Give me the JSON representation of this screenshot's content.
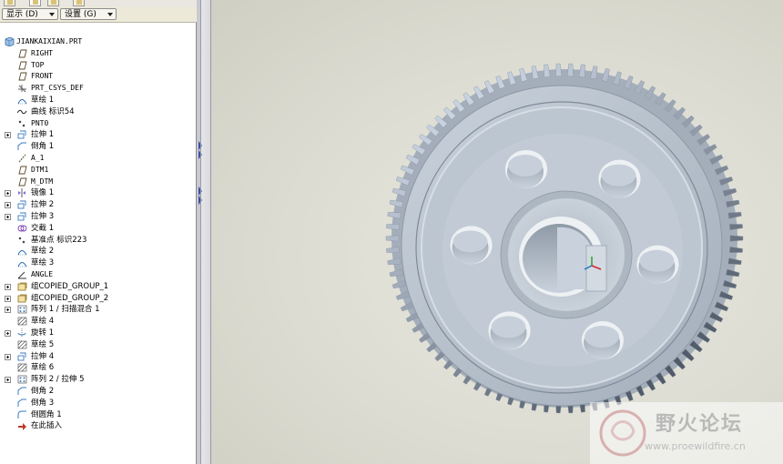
{
  "menubar": {
    "display_label": "显示 (D)",
    "settings_label": "设置 (G)"
  },
  "model_tree": {
    "root": "JIANKAIXIAN.PRT",
    "items": [
      {
        "label": "RIGHT",
        "icon": "datum-plane-icon",
        "expandable": false
      },
      {
        "label": "TOP",
        "icon": "datum-plane-icon",
        "expandable": false
      },
      {
        "label": "FRONT",
        "icon": "datum-plane-icon",
        "expandable": false
      },
      {
        "label": "PRT_CSYS_DEF",
        "icon": "csys-icon",
        "expandable": false
      },
      {
        "label": "草绘 1",
        "icon": "sketch-icon",
        "expandable": false
      },
      {
        "label": "曲线 标识54",
        "icon": "curve-icon",
        "expandable": false
      },
      {
        "label": "PNT0",
        "icon": "datum-point-icon",
        "expandable": false
      },
      {
        "label": "拉伸 1",
        "icon": "extrude-icon",
        "expandable": true
      },
      {
        "label": "倒角 1",
        "icon": "chamfer-icon",
        "expandable": false
      },
      {
        "label": "A_1",
        "icon": "datum-axis-icon",
        "expandable": false
      },
      {
        "label": "DTM1",
        "icon": "datum-plane-icon",
        "expandable": false
      },
      {
        "label": "M_DTM",
        "icon": "datum-plane-icon",
        "expandable": false
      },
      {
        "label": "镜像 1",
        "icon": "mirror-icon",
        "expandable": true
      },
      {
        "label": "拉伸 2",
        "icon": "extrude-icon",
        "expandable": true
      },
      {
        "label": "拉伸 3",
        "icon": "extrude-icon",
        "expandable": true
      },
      {
        "label": "交截 1",
        "icon": "intersect-icon",
        "expandable": false
      },
      {
        "label": "基准点 标识223",
        "icon": "datum-point-icon",
        "expandable": false
      },
      {
        "label": "草绘 2",
        "icon": "sketch-icon",
        "expandable": false
      },
      {
        "label": "草绘 3",
        "icon": "sketch-icon",
        "expandable": false
      },
      {
        "label": "ANGLE",
        "icon": "angle-icon",
        "expandable": false
      },
      {
        "label": "组COPIED_GROUP_1",
        "icon": "group-icon",
        "expandable": true
      },
      {
        "label": "组COPIED_GROUP_2",
        "icon": "group-icon",
        "expandable": true
      },
      {
        "label": "阵列 1 / 扫描混合 1",
        "icon": "pattern-icon",
        "expandable": true
      },
      {
        "label": "草绘 4",
        "icon": "sketch-hatch-icon",
        "expandable": false
      },
      {
        "label": "旋转 1",
        "icon": "revolve-icon",
        "expandable": true
      },
      {
        "label": "草绘 5",
        "icon": "sketch-hatch-icon",
        "expandable": false
      },
      {
        "label": "拉伸 4",
        "icon": "extrude-icon",
        "expandable": true
      },
      {
        "label": "草绘 6",
        "icon": "sketch-hatch-icon",
        "expandable": false
      },
      {
        "label": "阵列 2 / 拉伸 5",
        "icon": "pattern-icon",
        "expandable": true
      },
      {
        "label": "倒角 2",
        "icon": "chamfer-icon",
        "expandable": false
      },
      {
        "label": "倒角 3",
        "icon": "chamfer-icon",
        "expandable": false
      },
      {
        "label": "倒圆角 1",
        "icon": "round-icon",
        "expandable": false
      },
      {
        "label": "在此插入",
        "icon": "insert-here-arrow-icon",
        "expandable": false
      }
    ]
  },
  "watermark": {
    "name": "野火论坛",
    "url": "www.proewildfire.cn"
  },
  "colors": {
    "viewport_bg": "#dcdcd2",
    "gear_body": "#b9c3cd",
    "insert_arrow": "#c0392b"
  }
}
